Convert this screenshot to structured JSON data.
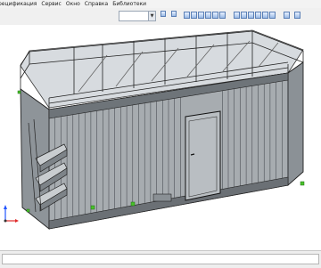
{
  "menu": {
    "items": [
      "рецификация",
      "Сервис",
      "Окно",
      "Справка",
      "Библиотеки"
    ]
  },
  "toolbar": {
    "zoom_value": "",
    "buttons": [
      "select-tool",
      "rotate-tool",
      "view-orientation",
      "zoom-fit",
      "zoom-in",
      "pan",
      "shaded",
      "wireframe",
      "hidden-lines",
      "perspective",
      "section-view",
      "measure",
      "grid",
      "snap",
      "orientation-cube",
      "more"
    ]
  },
  "viewport": {
    "model_name": "container-module",
    "axis_y": "Y",
    "axis_x": "X"
  },
  "colors": {
    "background": "#ffffff",
    "model_lines": "#222222",
    "model_fill": "#9ea4a9",
    "accent_green": "#49c22a",
    "axis_blue": "#2255ff",
    "axis_red": "#e02a2a"
  }
}
